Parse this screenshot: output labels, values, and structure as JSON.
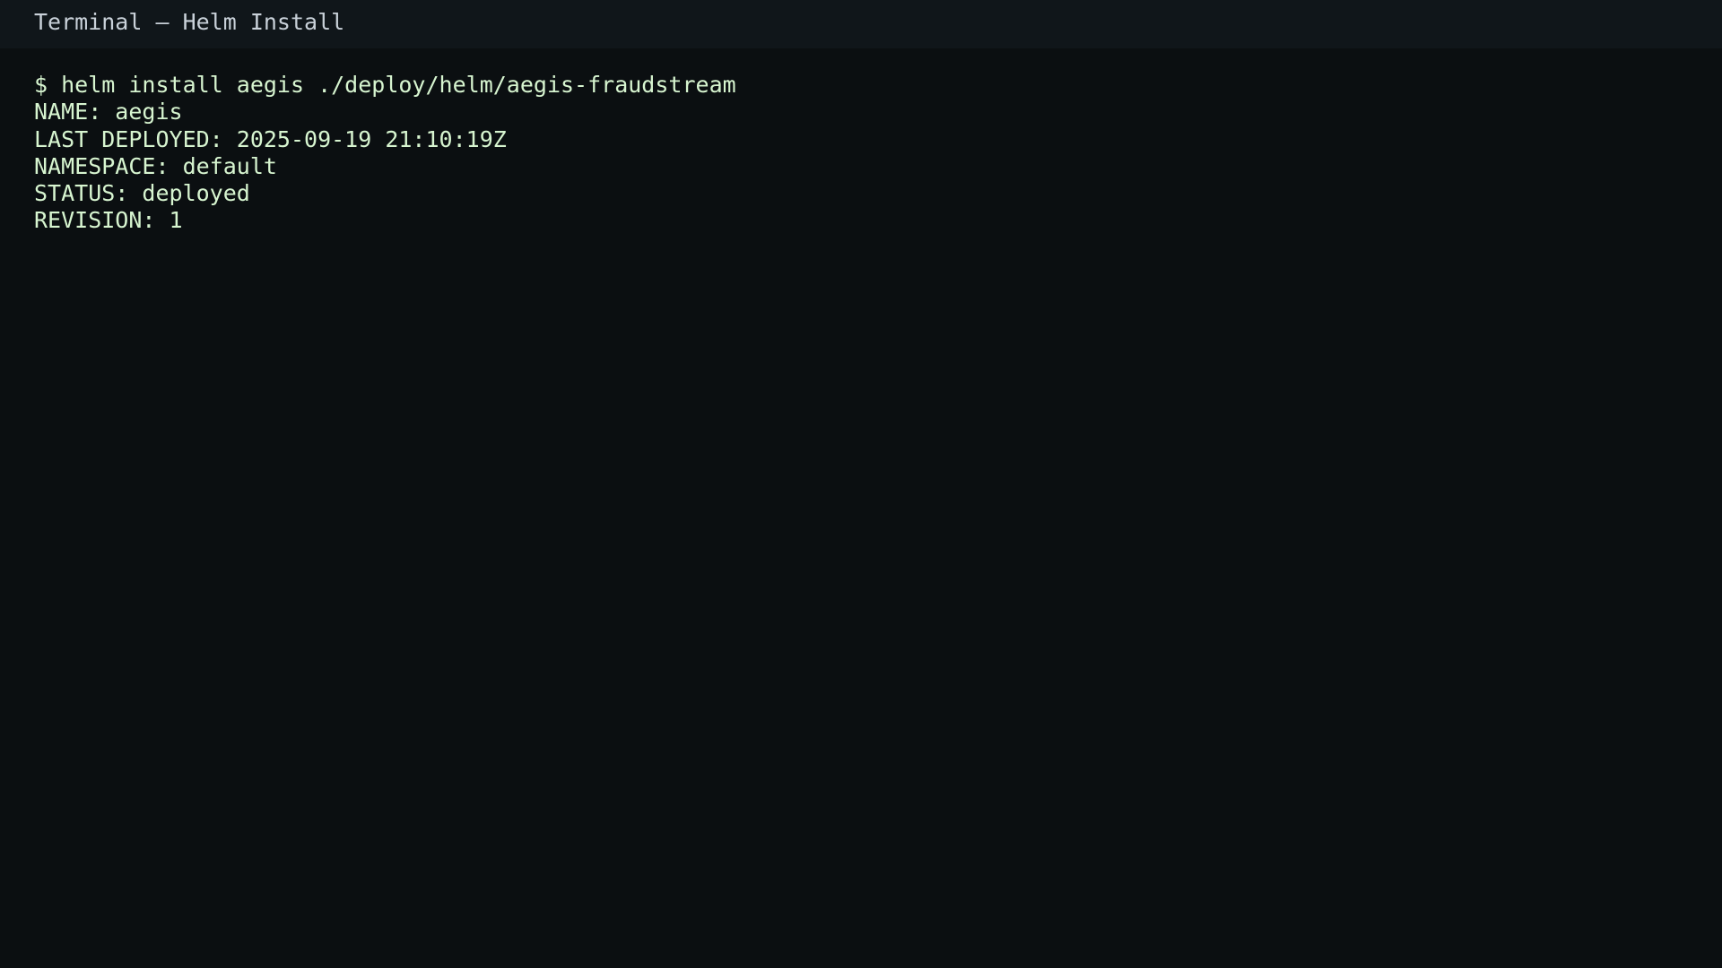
{
  "window": {
    "title": "Terminal — Helm Install"
  },
  "terminal": {
    "command": "$ helm install aegis ./deploy/helm/aegis-fraudstream",
    "output": {
      "name": "NAME: aegis",
      "last_deployed": "LAST DEPLOYED: 2025-09-19 21:10:19Z",
      "namespace": "NAMESPACE: default",
      "status": "STATUS: deployed",
      "revision": "REVISION: 1"
    }
  },
  "colors": {
    "background": "#0b0f11",
    "titlebar": "#10161a",
    "text": "#d7f5d0",
    "title_text": "#c9d1d9"
  }
}
